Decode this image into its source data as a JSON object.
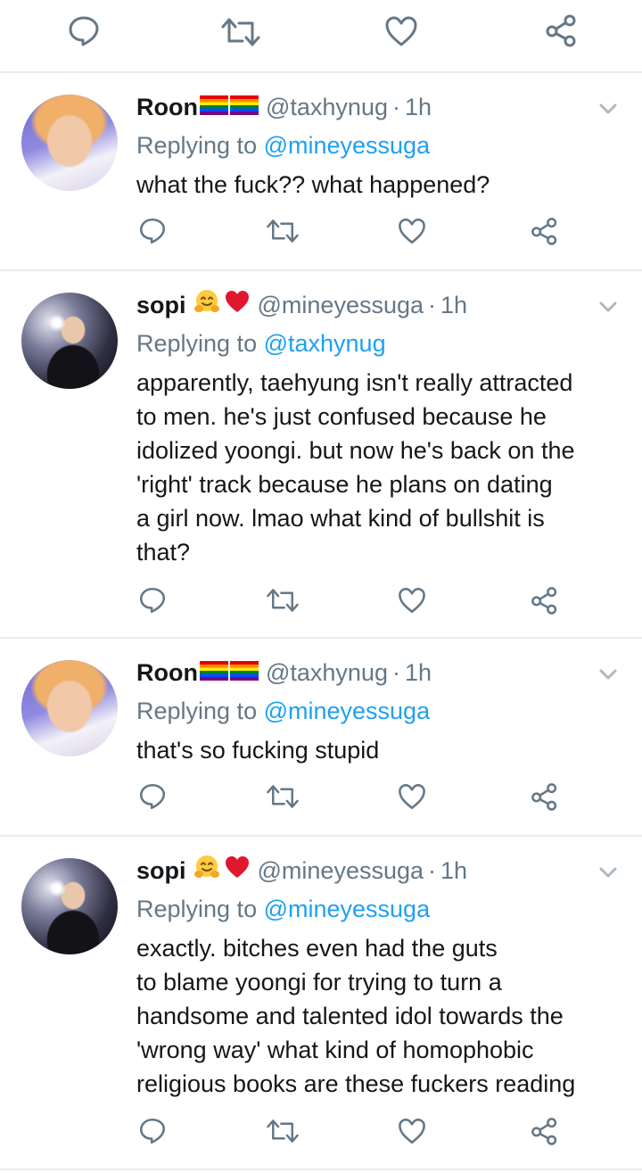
{
  "top_actions": {
    "icons": [
      "reply-icon",
      "retweet-icon",
      "like-icon",
      "share-icon"
    ]
  },
  "tweets": [
    {
      "display_name": "Roon",
      "name_emojis": [
        "rainbow-flag",
        "rainbow-flag"
      ],
      "handle": "@taxhynug",
      "time": "1h",
      "replying_prefix": "Replying to ",
      "replying_to": "@mineyessuga",
      "text": "what the fuck?? what happened?"
    },
    {
      "display_name": "sopi",
      "name_emojis": [
        "hugging-face",
        "red-heart"
      ],
      "handle": "@mineyessuga",
      "time": "1h",
      "replying_prefix": "Replying to ",
      "replying_to": "@taxhynug",
      "text": "apparently, taehyung isn't really attracted\nto men. he's just confused because he\nidolized yoongi. but now he's back on the\n'right' track because he plans on dating\na girl now. lmao what kind of bullshit is\nthat?"
    },
    {
      "display_name": "Roon",
      "name_emojis": [
        "rainbow-flag",
        "rainbow-flag"
      ],
      "handle": "@taxhynug",
      "time": "1h",
      "replying_prefix": "Replying to ",
      "replying_to": "@mineyessuga",
      "text": "that's so fucking stupid"
    },
    {
      "display_name": "sopi",
      "name_emojis": [
        "hugging-face",
        "red-heart"
      ],
      "handle": "@mineyessuga",
      "time": "1h",
      "replying_prefix": "Replying to ",
      "replying_to": "@mineyessuga",
      "text": "exactly. bitches even had the guts\nto blame yoongi for trying to turn a\nhandsome and talented idol towards the\n'wrong way' what kind of homophobic\nreligious books are these fuckers reading"
    }
  ],
  "colors": {
    "text": "#14171a",
    "secondary": "#657786",
    "link": "#1da1f2",
    "icon": "#657786",
    "divider": "#e6ecf0"
  }
}
